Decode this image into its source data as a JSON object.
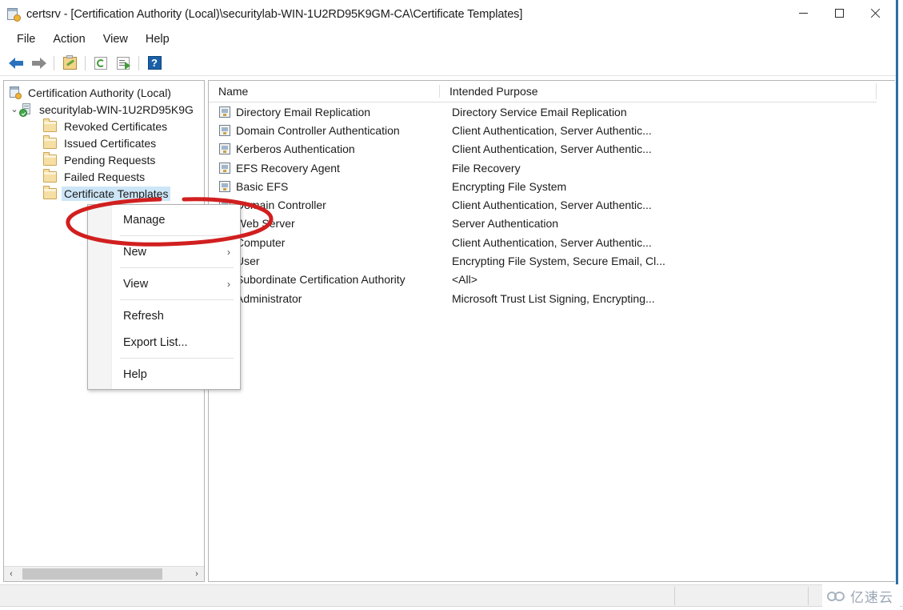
{
  "window": {
    "title": "certsrv - [Certification Authority (Local)\\securitylab-WIN-1U2RD95K9GM-CA\\Certificate Templates]",
    "title_icon": "certification-authority-icon",
    "controls": {
      "minimize": "minimize-icon",
      "maximize": "maximize-icon",
      "close": "close-icon"
    }
  },
  "menubar": {
    "items": [
      {
        "label": "File"
      },
      {
        "label": "Action"
      },
      {
        "label": "View"
      },
      {
        "label": "Help"
      }
    ]
  },
  "toolbar": {
    "buttons": [
      {
        "name": "back-arrow-icon",
        "tooltip": "Back"
      },
      {
        "name": "forward-arrow-icon",
        "tooltip": "Forward"
      },
      {
        "name": "show-hide-console-tree-icon",
        "tooltip": "Show/Hide Console Tree"
      },
      {
        "name": "refresh-icon",
        "tooltip": "Refresh"
      },
      {
        "name": "export-list-icon",
        "tooltip": "Export List"
      },
      {
        "name": "help-icon",
        "tooltip": "Help",
        "glyph": "?"
      }
    ]
  },
  "tree": {
    "items": [
      {
        "label": "Certification Authority (Local)",
        "icon": "certification-authority-icon",
        "indent": 0,
        "chevron": "",
        "selected": false
      },
      {
        "label": "securitylab-WIN-1U2RD95K9G",
        "icon": "ca-server-icon",
        "indent": 1,
        "chevron": "⌄",
        "selected": false
      },
      {
        "label": "Revoked Certificates",
        "icon": "folder-icon",
        "indent": 2,
        "chevron": "",
        "selected": false
      },
      {
        "label": "Issued Certificates",
        "icon": "folder-icon",
        "indent": 2,
        "chevron": "",
        "selected": false
      },
      {
        "label": "Pending Requests",
        "icon": "folder-icon",
        "indent": 2,
        "chevron": "",
        "selected": false
      },
      {
        "label": "Failed Requests",
        "icon": "folder-icon",
        "indent": 2,
        "chevron": "",
        "selected": false
      },
      {
        "label": "Certificate Templates",
        "icon": "folder-icon",
        "indent": 2,
        "chevron": "",
        "selected": true
      }
    ],
    "scrollbar": {
      "left_arrow": "‹",
      "right_arrow": "›"
    }
  },
  "list": {
    "columns": [
      {
        "label": "Name"
      },
      {
        "label": "Intended Purpose"
      }
    ],
    "rows": [
      {
        "name": "Directory Email Replication",
        "purpose": "Directory Service Email Replication",
        "icon": "certificate-template-icon"
      },
      {
        "name": "Domain Controller Authentication",
        "purpose": "Client Authentication, Server Authentic...",
        "icon": "certificate-template-icon"
      },
      {
        "name": "Kerberos Authentication",
        "purpose": "Client Authentication, Server Authentic...",
        "icon": "certificate-template-icon"
      },
      {
        "name": "EFS Recovery Agent",
        "purpose": "File Recovery",
        "icon": "certificate-template-icon"
      },
      {
        "name": "Basic EFS",
        "purpose": "Encrypting File System",
        "icon": "certificate-template-icon"
      },
      {
        "name": "Domain Controller",
        "purpose": "Client Authentication, Server Authentic...",
        "icon": "certificate-template-icon"
      },
      {
        "name": "Web Server",
        "purpose": "Server Authentication",
        "icon": "certificate-template-icon"
      },
      {
        "name": "Computer",
        "purpose": "Client Authentication, Server Authentic...",
        "icon": "certificate-template-icon"
      },
      {
        "name": "User",
        "purpose": "Encrypting File System, Secure Email, Cl...",
        "icon": "certificate-template-icon"
      },
      {
        "name": "Subordinate Certification Authority",
        "purpose": "<All>",
        "icon": "certificate-template-icon"
      },
      {
        "name": "Administrator",
        "purpose": "Microsoft Trust List Signing, Encrypting...",
        "icon": "certificate-template-icon"
      }
    ]
  },
  "context_menu": {
    "items": [
      {
        "label": "Manage",
        "submenu": ""
      },
      {
        "label": "New",
        "submenu": "›"
      },
      {
        "label": "View",
        "submenu": "›"
      },
      {
        "label": "Refresh",
        "submenu": ""
      },
      {
        "label": "Export List...",
        "submenu": ""
      },
      {
        "label": "Help",
        "submenu": ""
      }
    ]
  },
  "annotation": {
    "shape": "ellipse",
    "color": "#d11f1f",
    "target": "Manage"
  },
  "watermark": {
    "text": "亿速云",
    "icon": "cloud-icon"
  },
  "colors": {
    "accent": "#2c6ea4",
    "selection": "#cde6f7",
    "annotation_red": "#d11f1f",
    "window_bg": "#ffffff",
    "statusbar_bg": "#f0f0f0"
  }
}
